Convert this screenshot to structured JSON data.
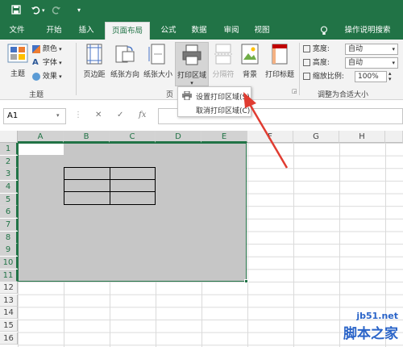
{
  "titlebar": {
    "save_icon": "save-icon",
    "undo_icon": "undo-icon",
    "redo_icon": "redo-icon",
    "customize_icon": "customize-qat-icon"
  },
  "tabs": [
    {
      "label": "文件"
    },
    {
      "label": "开始"
    },
    {
      "label": "插入"
    },
    {
      "label": "页面布局"
    },
    {
      "label": "公式"
    },
    {
      "label": "数据"
    },
    {
      "label": "审阅"
    },
    {
      "label": "视图"
    },
    {
      "label": "操作说明搜索"
    }
  ],
  "ribbon": {
    "theme": {
      "main": "主题",
      "colors": "颜色",
      "fonts": "字体",
      "effects": "效果",
      "group": "主题"
    },
    "page_setup": {
      "margins": "页边距",
      "orientation": "纸张方向",
      "size": "纸张大小",
      "print_area": "打印区域",
      "breaks": "分隔符",
      "background": "背景",
      "print_titles": "打印标题",
      "group_partial": "页"
    },
    "scale": {
      "width_label": "宽度:",
      "width_value": "自动",
      "height_label": "高度:",
      "height_value": "自动",
      "scale_label": "缩放比例:",
      "scale_value": "100%",
      "group": "调整为合适大小"
    }
  },
  "formula_bar": {
    "name_box": "A1",
    "cancel": "✕",
    "confirm": "✓",
    "fx": "fx",
    "value": ""
  },
  "columns": [
    "A",
    "B",
    "C",
    "D",
    "E",
    "F",
    "G",
    "H"
  ],
  "rows": [
    "1",
    "2",
    "3",
    "4",
    "5",
    "6",
    "7",
    "8",
    "9",
    "10",
    "11",
    "12",
    "13",
    "14",
    "15",
    "16"
  ],
  "dropdown": {
    "set_print_area": "设置打印区域(S)",
    "clear_print_area": "取消打印区域(C)"
  },
  "watermark": {
    "site": "jb51.net",
    "name": "脚本之家"
  },
  "colors": {
    "accent": "#217346",
    "arrow": "#e03c31"
  }
}
